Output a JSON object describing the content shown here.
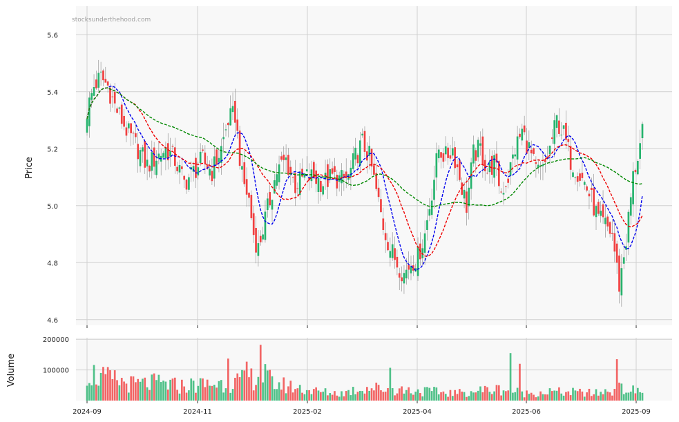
{
  "watermark": "stocksunderthehood.com",
  "colors": {
    "up": "#26b36d",
    "down": "#f04040",
    "ma_short": "#0000ee",
    "ma_mid": "#ee0000",
    "ma_long": "#008800",
    "grid": "#d0d0d0",
    "panel_bg": "#f8f8f8"
  },
  "chart_data": [
    {
      "type": "candlestick",
      "ylabel": "Price",
      "ylim": [
        4.58,
        5.7
      ],
      "yticks": [
        "4.6",
        "4.8",
        "5.0",
        "5.2",
        "5.4",
        "5.6"
      ],
      "x_ticks": [
        "2024-09",
        "2024-11",
        "2025-02",
        "2025-04",
        "2025-06",
        "2025-09"
      ],
      "grid": true,
      "close_anchors": [
        [
          0,
          5.33
        ],
        [
          3,
          5.42
        ],
        [
          6,
          5.45
        ],
        [
          9,
          5.42
        ],
        [
          12,
          5.35
        ],
        [
          15,
          5.3
        ],
        [
          18,
          5.25
        ],
        [
          22,
          5.2
        ],
        [
          26,
          5.14
        ],
        [
          30,
          5.17
        ],
        [
          34,
          5.2
        ],
        [
          38,
          5.16
        ],
        [
          42,
          5.08
        ],
        [
          46,
          5.12
        ],
        [
          50,
          5.16
        ],
        [
          54,
          5.12
        ],
        [
          58,
          5.2
        ],
        [
          61,
          5.3
        ],
        [
          64,
          5.32
        ],
        [
          67,
          5.1
        ],
        [
          70,
          5.02
        ],
        [
          72,
          4.9
        ],
        [
          74,
          4.85
        ],
        [
          76,
          4.92
        ],
        [
          79,
          5.02
        ],
        [
          82,
          5.12
        ],
        [
          86,
          5.16
        ],
        [
          90,
          5.07
        ],
        [
          94,
          5.1
        ],
        [
          98,
          5.1
        ],
        [
          102,
          5.08
        ],
        [
          106,
          5.1
        ],
        [
          110,
          5.09
        ],
        [
          113,
          5.1
        ],
        [
          116,
          5.17
        ],
        [
          119,
          5.22
        ],
        [
          122,
          5.17
        ],
        [
          125,
          5.05
        ],
        [
          128,
          4.93
        ],
        [
          131,
          4.85
        ],
        [
          134,
          4.8
        ],
        [
          137,
          4.76
        ],
        [
          140,
          4.8
        ],
        [
          143,
          4.82
        ],
        [
          146,
          4.9
        ],
        [
          149,
          5.05
        ],
        [
          152,
          5.2
        ],
        [
          155,
          5.17
        ],
        [
          158,
          5.2
        ],
        [
          161,
          5.1
        ],
        [
          164,
          5.0
        ],
        [
          167,
          5.18
        ],
        [
          170,
          5.2
        ],
        [
          173,
          5.12
        ],
        [
          176,
          5.15
        ],
        [
          179,
          5.05
        ],
        [
          182,
          5.1
        ],
        [
          185,
          5.2
        ],
        [
          188,
          5.26
        ],
        [
          191,
          5.2
        ],
        [
          194,
          5.12
        ],
        [
          197,
          5.12
        ],
        [
          200,
          5.2
        ],
        [
          203,
          5.3
        ],
        [
          206,
          5.25
        ],
        [
          209,
          5.16
        ],
        [
          212,
          5.12
        ],
        [
          215,
          5.08
        ],
        [
          218,
          5.02
        ],
        [
          221,
          4.95
        ],
        [
          224,
          4.93
        ],
        [
          227,
          4.9
        ],
        [
          230,
          4.72
        ],
        [
          233,
          4.88
        ],
        [
          236,
          5.1
        ],
        [
          240,
          5.25
        ]
      ],
      "volume_anchors": [
        [
          0,
          105000
        ],
        [
          5,
          80000
        ],
        [
          12,
          70000
        ],
        [
          20,
          55000
        ],
        [
          30,
          60000
        ],
        [
          40,
          50000
        ],
        [
          50,
          55000
        ],
        [
          60,
          60000
        ],
        [
          70,
          70000
        ],
        [
          75,
          100000
        ],
        [
          80,
          60000
        ],
        [
          90,
          45000
        ],
        [
          100,
          30000
        ],
        [
          110,
          25000
        ],
        [
          120,
          45000
        ],
        [
          130,
          40000
        ],
        [
          140,
          35000
        ],
        [
          150,
          30000
        ],
        [
          160,
          25000
        ],
        [
          170,
          35000
        ],
        [
          180,
          40000
        ],
        [
          190,
          25000
        ],
        [
          200,
          30000
        ],
        [
          210,
          28000
        ],
        [
          220,
          25000
        ],
        [
          230,
          40000
        ],
        [
          240,
          30000
        ]
      ],
      "volume_spikes": [
        [
          61,
          137000
        ],
        [
          75,
          182000
        ],
        [
          69,
          127000
        ],
        [
          131,
          107000
        ],
        [
          183,
          155000
        ],
        [
          187,
          120000
        ],
        [
          229,
          135000
        ]
      ],
      "moving_averages": [
        {
          "window": 10,
          "color_key": "ma_short"
        },
        {
          "window": 20,
          "color_key": "ma_mid"
        },
        {
          "window": 50,
          "color_key": "ma_long"
        }
      ]
    },
    {
      "type": "bar",
      "ylabel": "Volume",
      "ylim": [
        0,
        205000
      ],
      "yticks": [
        "100000",
        "200000"
      ]
    }
  ]
}
